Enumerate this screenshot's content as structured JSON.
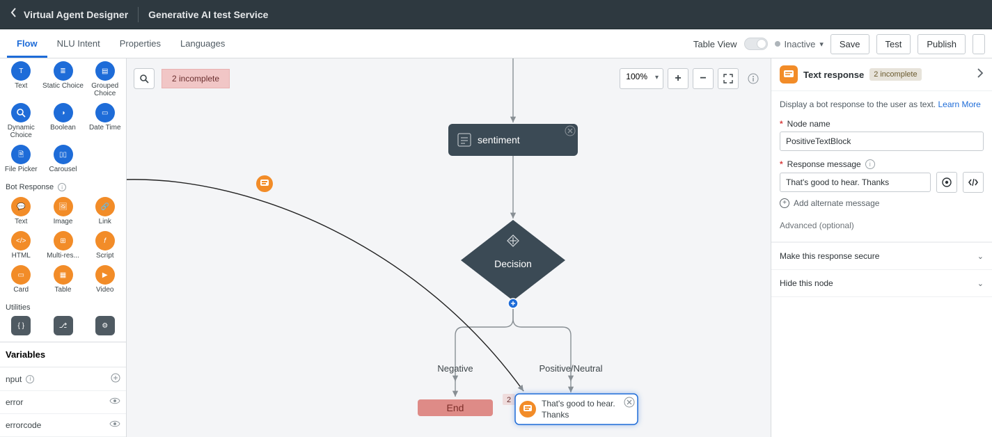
{
  "header": {
    "app_title": "Virtual Agent Designer",
    "service_name": "Generative AI test Service"
  },
  "tabs": [
    {
      "label": "Flow",
      "active": true
    },
    {
      "label": "NLU Intent"
    },
    {
      "label": "Properties"
    },
    {
      "label": "Languages"
    }
  ],
  "toolbar_right": {
    "table_view_label": "Table View",
    "status_label": "Inactive",
    "save": "Save",
    "test": "Test",
    "publish": "Publish"
  },
  "palette": {
    "user_input": [
      {
        "label": "Text"
      },
      {
        "label": "Static Choice"
      },
      {
        "label": "Grouped Choice"
      },
      {
        "label": "Dynamic Choice"
      },
      {
        "label": "Boolean"
      },
      {
        "label": "Date Time"
      },
      {
        "label": "File Picker"
      },
      {
        "label": "Carousel"
      }
    ],
    "section_bot_response": "Bot Response",
    "bot_response": [
      {
        "label": "Text"
      },
      {
        "label": "Image"
      },
      {
        "label": "Link"
      },
      {
        "label": "HTML"
      },
      {
        "label": "Multi-res..."
      },
      {
        "label": "Script"
      },
      {
        "label": "Card"
      },
      {
        "label": "Table"
      },
      {
        "label": "Video"
      }
    ],
    "section_utilities": "Utilities"
  },
  "variables": {
    "header": "Variables",
    "rows": [
      {
        "label": "nput",
        "icon": "info-plus"
      },
      {
        "label": "error",
        "icon": "eye"
      },
      {
        "label": "errorcode",
        "icon": "eye"
      }
    ]
  },
  "canvas": {
    "incomplete_badge": "2 incomplete",
    "zoom": "100%",
    "nodes": {
      "sentiment": "sentiment",
      "decision": "Decision",
      "branch_negative": "Negative",
      "branch_positive": "Positive/Neutral",
      "end": "End",
      "text_block_line1": "That's good to hear.",
      "text_block_line2": "Thanks",
      "mini_badge": "2"
    }
  },
  "right_panel": {
    "title": "Text response",
    "title_badge": "2 incomplete",
    "description": "Display a bot response to the user as text. ",
    "learn_more": "Learn More",
    "node_name_label": "Node name",
    "node_name_value": "PositiveTextBlock",
    "response_msg_label": "Response message",
    "response_msg_value": "That's good to hear. Thanks",
    "add_alternate": "Add alternate message",
    "advanced": "Advanced (optional)",
    "acc_secure": "Make this response secure",
    "acc_hide": "Hide this node"
  }
}
